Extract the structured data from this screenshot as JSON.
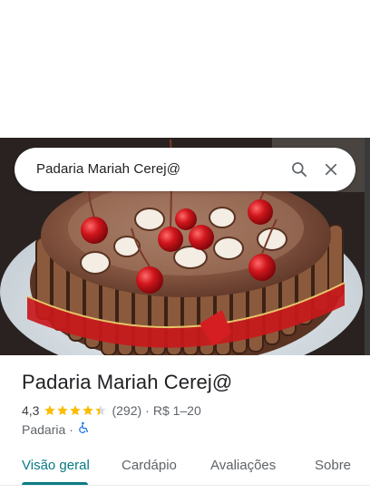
{
  "search": {
    "query": "Padaria Mariah Cerej@",
    "search_icon": "search-icon",
    "close_icon": "close-icon"
  },
  "photo": {
    "subject": "cake-photo"
  },
  "place": {
    "name": "Padaria Mariah Cerej@",
    "rating": "4,3",
    "stars": 4.3,
    "reviews": "(292)",
    "price": "R$ 1–20",
    "category": "Padaria",
    "accessibility_icon": "wheelchair-icon",
    "separator": "·"
  },
  "tabs": [
    {
      "label": "Visão geral",
      "active": true
    },
    {
      "label": "Cardápio",
      "active": false
    },
    {
      "label": "Avaliações",
      "active": false
    },
    {
      "label": "Sobre",
      "active": false
    }
  ],
  "colors": {
    "accent": "#0a7a83",
    "star": "#fbbc04",
    "accessibility": "#1a73e8"
  }
}
